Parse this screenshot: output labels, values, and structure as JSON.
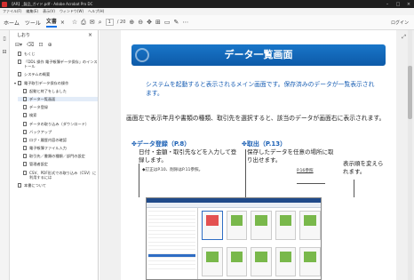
{
  "window": {
    "title": "【AR】_製品_ガイド.pdf - Adobe Acrobat Pro DC",
    "min": "–",
    "max": "□",
    "close": "×"
  },
  "menubar": [
    "ファイル(F)",
    "編集(E)",
    "表示(V)",
    "ウィンドウ(W)",
    "ヘルプ(H)"
  ],
  "toolbar": {
    "tabs": [
      "ホーム",
      "ツール",
      "文書"
    ],
    "tab_close": "×",
    "page_current": "1",
    "page_total": "/ 20",
    "signin": "ログイン",
    "tool_icons": [
      "☆",
      "⎙",
      "✉",
      "⌕",
      "⊕",
      "⊖",
      "✥",
      "⊞",
      "▭",
      "✎",
      "⋯"
    ]
  },
  "bookmarks": {
    "header": "しおり",
    "close": "×",
    "items": [
      {
        "label": "もくじ",
        "child": false
      },
      {
        "label": "「DDL 操作 電子帳簿データ保存」のインストール",
        "child": false
      },
      {
        "label": "システムの概要",
        "child": false
      },
      {
        "label": "電子取引データ保存の操作",
        "child": false,
        "expanded": true
      },
      {
        "label": "起動と終了をしました",
        "child": true
      },
      {
        "label": "データ一覧画面",
        "child": true
      },
      {
        "label": "データ登録",
        "child": true
      },
      {
        "label": "検索",
        "child": true
      },
      {
        "label": "データの取り込み（ダウンロード）",
        "child": true
      },
      {
        "label": "バックアップ",
        "child": true
      },
      {
        "label": "ログ・履歴内容の確認",
        "child": true
      },
      {
        "label": "電子帳簿ファイル入力",
        "child": true
      },
      {
        "label": "取引先／書類の種類／部門の設定",
        "child": true
      },
      {
        "label": "管理者設定",
        "child": true
      },
      {
        "label": "CSV、PDF形式での取り込み（CSV）に利用するには",
        "child": true
      },
      {
        "label": "本書について",
        "child": false
      }
    ]
  },
  "document": {
    "banner_title": "データ一覧画面",
    "intro": "システムを起動すると表示されるメイン画面です。保存済みのデータが一覧表示されます。",
    "desc": "画面左で表示年月や書類の種類、取引先を選択すると、該当のデータが画面右に表示されます。",
    "callout1": {
      "heading": "✤データ登録（P.8）",
      "body": "日付・金額・取引先などを入力して登録します。",
      "sub": "◆訂正はP.10、削除はP.11参照。"
    },
    "callout2": {
      "heading": "✤取出（P.13）",
      "body": "保存したデータを任意の場所に取り出せます。",
      "sub": "P.16参照"
    },
    "callout3": {
      "body": "表示順を変えられます。"
    }
  }
}
